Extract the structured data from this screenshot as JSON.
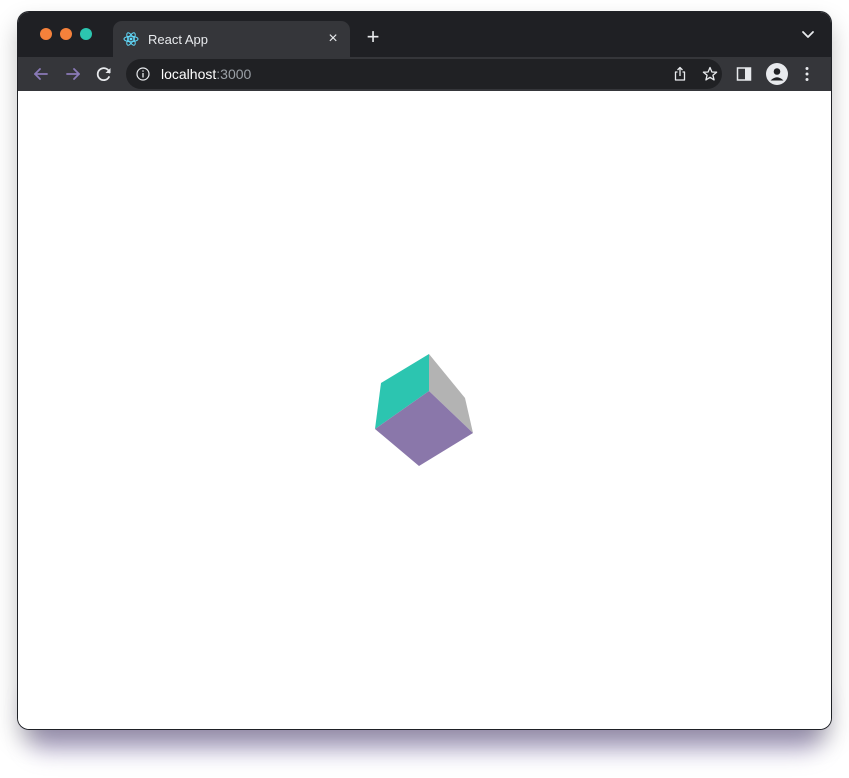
{
  "window": {
    "tab": {
      "title": "React App",
      "close_glyph": "×",
      "favicon": "react-logo-icon"
    },
    "new_tab_glyph": "+",
    "address_bar": {
      "host": "localhost",
      "port": ":3000"
    }
  },
  "colors": {
    "titlebar": "#1f2024",
    "toolbar": "#35363a",
    "omnibox": "#202124",
    "traffic_close": "#f5813b",
    "traffic_minimize": "#f5813b",
    "traffic_maximize": "#2cc5b0",
    "nav_arrows": "#8a7ab8",
    "cube_top": "#2cc5b0",
    "cube_front": "#8a77aa",
    "cube_side": "#b3b3b3"
  },
  "icons": [
    "back-arrow-icon",
    "forward-arrow-icon",
    "reload-icon",
    "info-icon",
    "share-icon",
    "star-icon",
    "side-panel-icon",
    "profile-icon",
    "menu-icon",
    "tab-search-icon"
  ]
}
